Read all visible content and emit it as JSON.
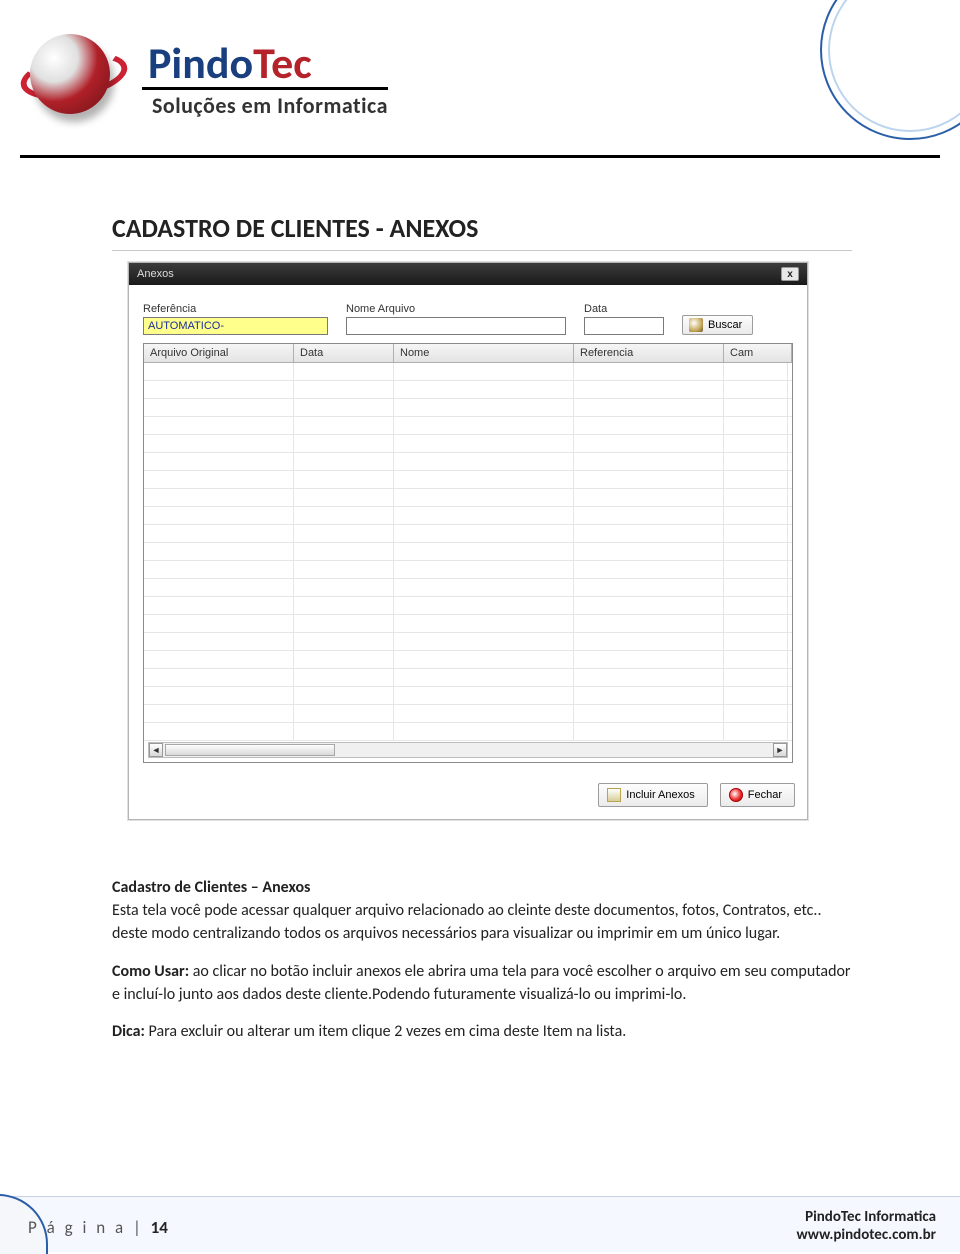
{
  "header": {
    "logo_name": "PindoTec",
    "logo_sub": "Soluções em Informatica"
  },
  "section_title": "CADASTRO DE CLIENTES  - ANEXOS",
  "dialog": {
    "title": "Anexos",
    "fields": {
      "referencia": {
        "label": "Referência",
        "value": "AUTOMATICO-"
      },
      "nome_arquivo": {
        "label": "Nome Arquivo",
        "value": ""
      },
      "data": {
        "label": "Data",
        "value": ""
      }
    },
    "buscar_label": "Buscar",
    "grid_columns": [
      "Arquivo Original",
      "Data",
      "Nome",
      "Referencia",
      "Cam"
    ],
    "incluir_label": "Incluir Anexos",
    "fechar_label": "Fechar"
  },
  "body": {
    "heading": "Cadastro de Clientes – Anexos",
    "p1": "Esta tela você pode acessar qualquer arquivo relacionado ao cleinte deste documentos, fotos, Contratos, etc.. deste modo centralizando todos os arquivos necessários para visualizar ou imprimir em um único lugar.",
    "p2_label": "Como Usar:",
    "p2": " ao clicar no botão incluir anexos ele abrira uma tela para você escolher o arquivo em seu computador e incluí-lo junto aos dados deste cliente.Podendo futuramente visualizá-lo ou imprimi-lo.",
    "p3_label": "Dica:",
    "p3": " Para excluir ou alterar um item clique 2 vezes em cima deste Item na  lista."
  },
  "footer": {
    "page_label": "P á g i n a | ",
    "page_num": "14",
    "company": "PindoTec Informatica",
    "url": "www.pindotec.com.br"
  }
}
